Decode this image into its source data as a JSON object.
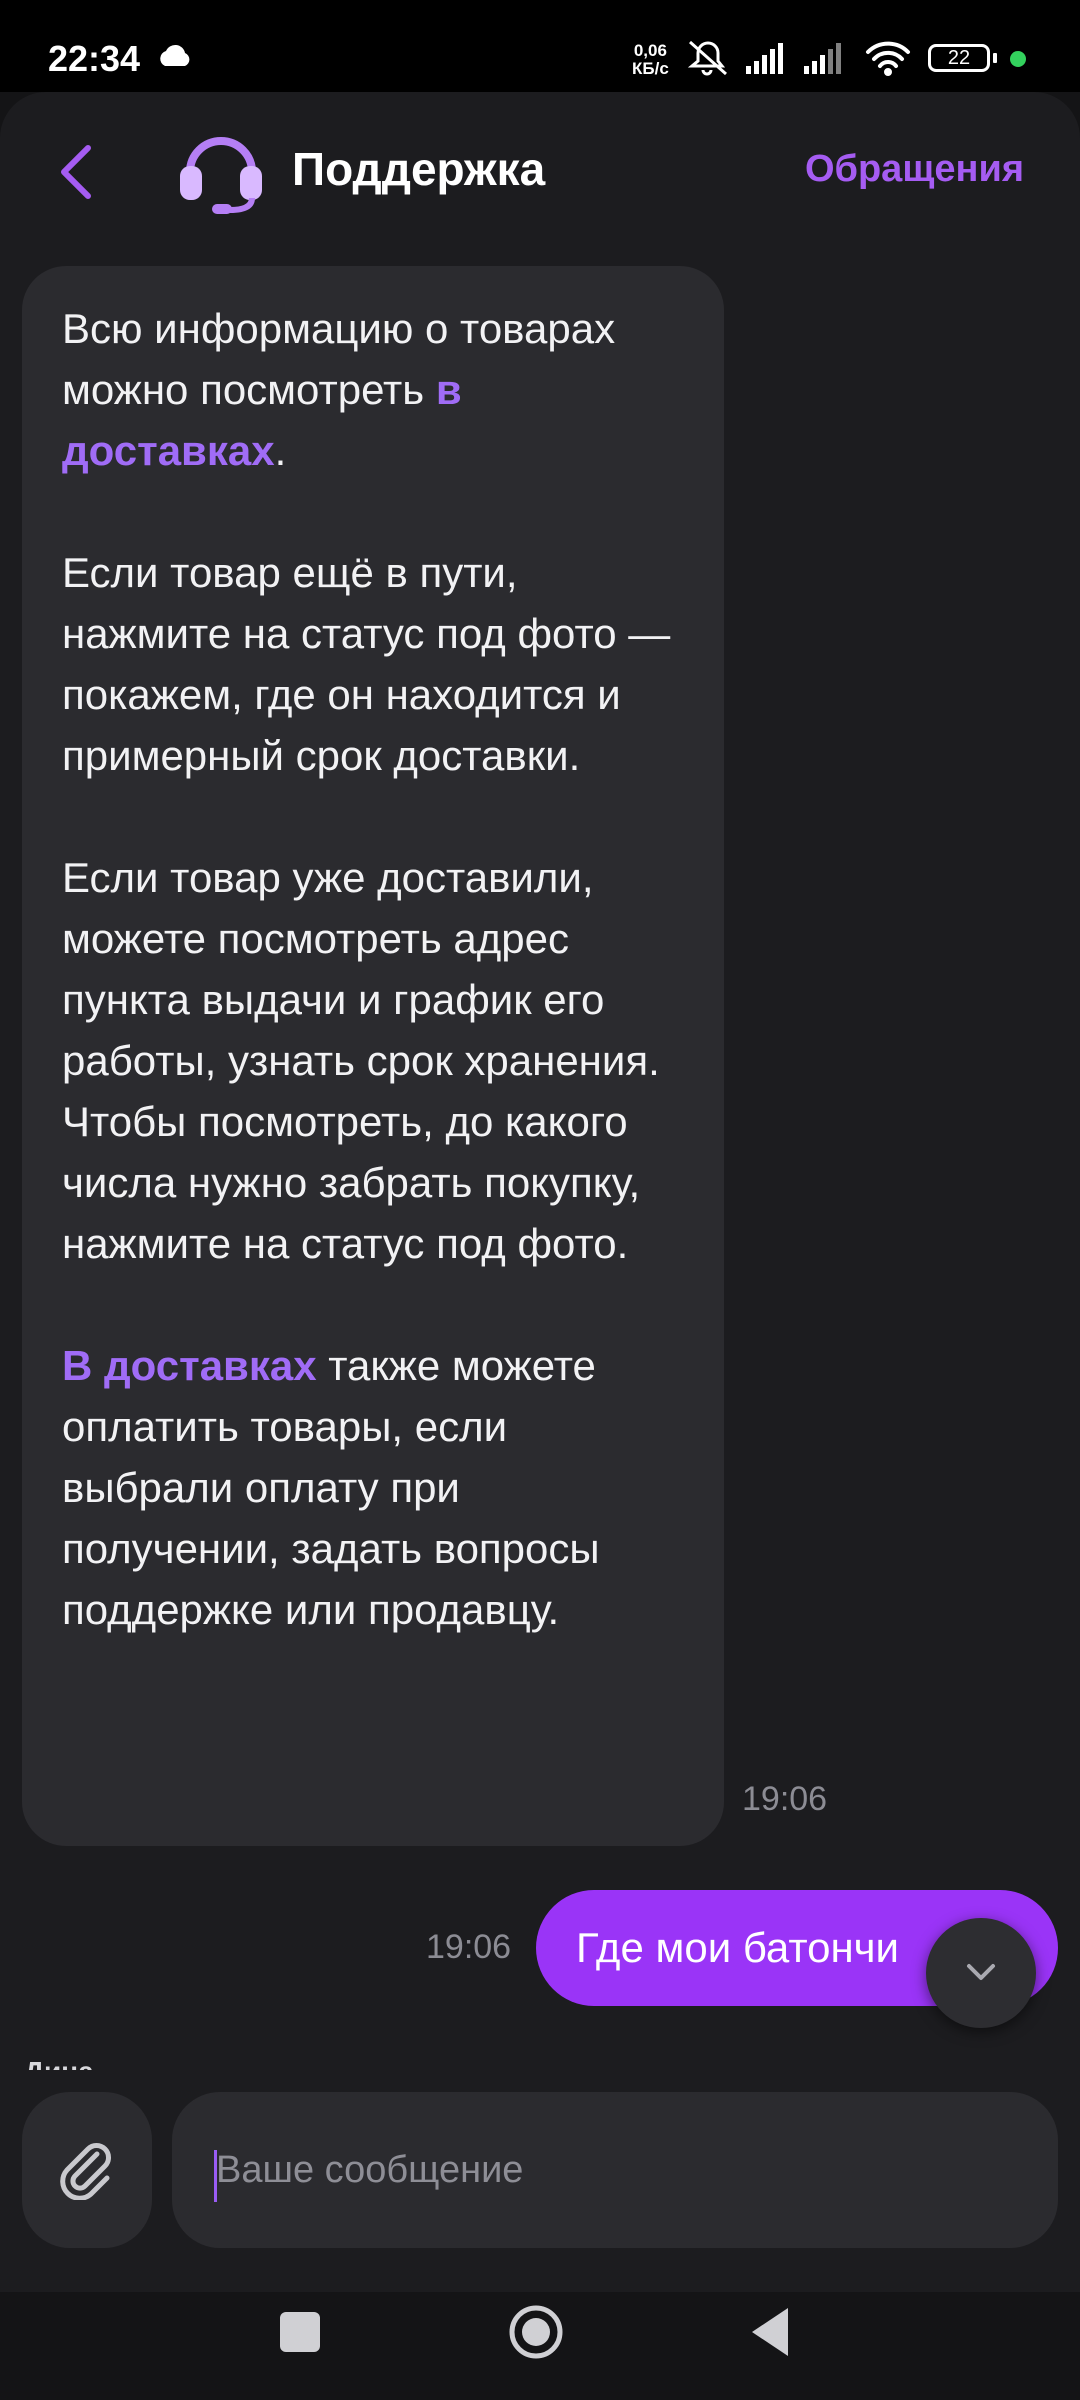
{
  "status_bar": {
    "time": "22:34",
    "net_speed_value": "0,06",
    "net_speed_unit": "КБ/с",
    "battery": "22",
    "icons": [
      "cloud-icon",
      "mute-icon",
      "signal-icon",
      "signal-icon",
      "wifi-icon",
      "battery-icon"
    ]
  },
  "header": {
    "title": "Поддержка",
    "requests_link": "Обращения",
    "accent_color": "#a55cf2"
  },
  "messages": {
    "incoming": {
      "p1_text": "Всю информацию о товарах можно посмотреть ",
      "p1_link": "в доставках",
      "p1_end": ".",
      "p2": "Если товар ещё в пути, нажмите на статус под фото — покажем, где он находится и примерный срок доставки.",
      "p3": "Если товар уже доставили, можете посмотреть адрес пункта выдачи и график его работы, узнать срок хранения. Чтобы посмотреть, до какого числа нужно забрать покупку, нажмите на статус под фото.",
      "p4_link": "В доставках",
      "p4_text": " также можете оплатить товары, если выбрали оплату при получении, задать вопросы поддержке или продавцу.",
      "time": "19:06"
    },
    "outgoing": {
      "text": "Где мои батончи",
      "time": "19:06",
      "color": "#9a34f7"
    },
    "partial_next": "Дина"
  },
  "composer": {
    "placeholder": "Ваше сообщение"
  }
}
